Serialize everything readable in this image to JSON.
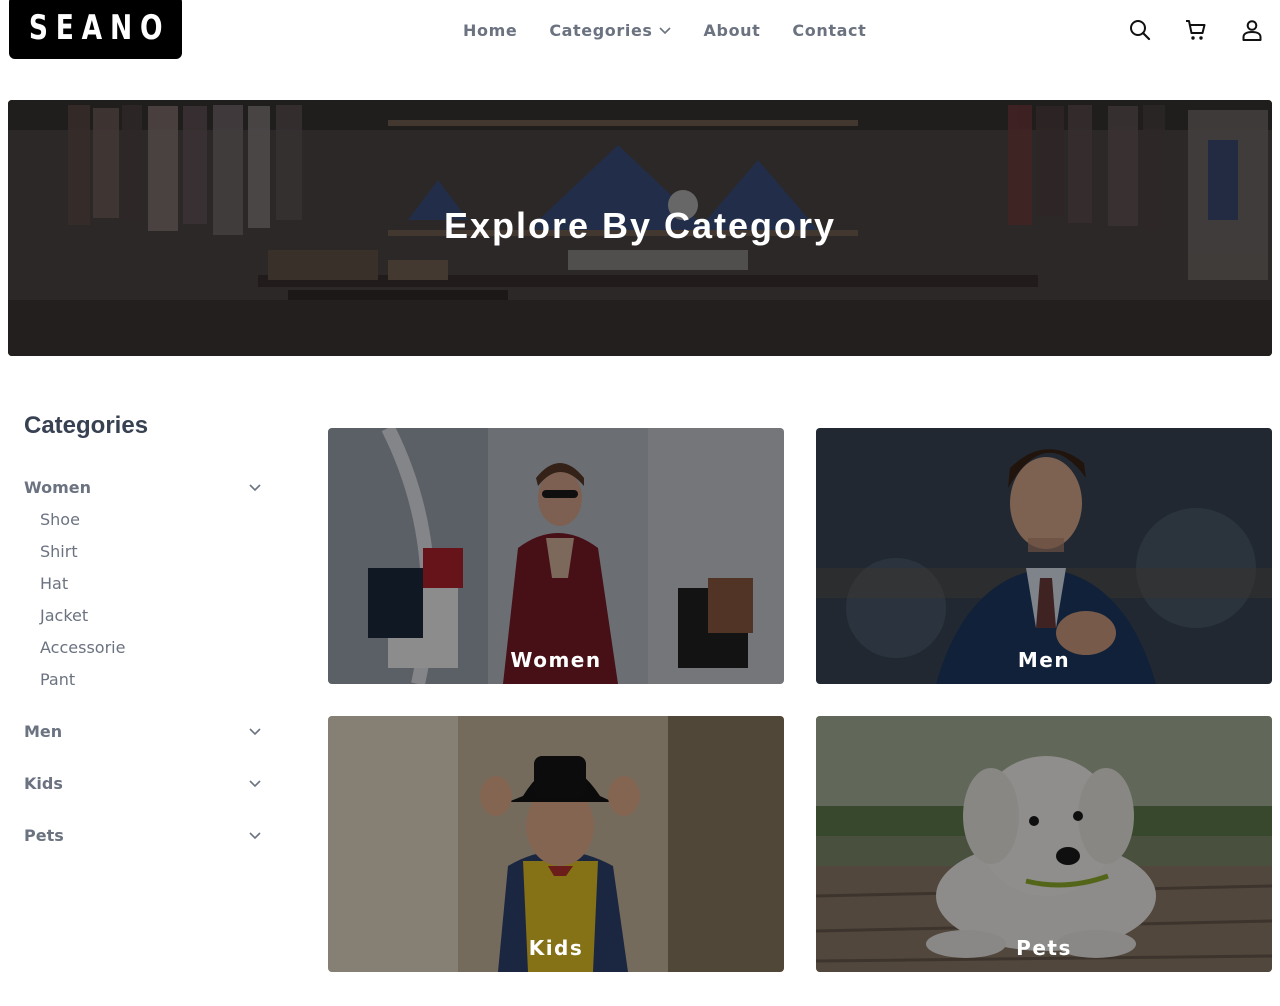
{
  "brand": {
    "logo_text": "SEANO"
  },
  "nav": {
    "items": [
      {
        "label": "Home"
      },
      {
        "label": "Categories",
        "has_dropdown": true
      },
      {
        "label": "About"
      },
      {
        "label": "Contact"
      }
    ]
  },
  "header_icons": [
    "search-icon",
    "cart-icon",
    "user-icon"
  ],
  "hero": {
    "title": "Explore By Category"
  },
  "sidebar": {
    "title": "Categories",
    "categories": [
      {
        "label": "Women",
        "expanded": true,
        "items": [
          "Shoe",
          "Shirt",
          "Hat",
          "Jacket",
          "Accessorie",
          "Pant"
        ]
      },
      {
        "label": "Men",
        "expanded": false
      },
      {
        "label": "Kids",
        "expanded": false
      },
      {
        "label": "Pets",
        "expanded": false
      }
    ]
  },
  "grid": {
    "cards": [
      {
        "label": "Women"
      },
      {
        "label": "Men"
      },
      {
        "label": "Kids"
      },
      {
        "label": "Pets"
      }
    ]
  },
  "colors": {
    "text_muted": "#6b7280",
    "heading": "#374151",
    "overlay": "#000000"
  }
}
